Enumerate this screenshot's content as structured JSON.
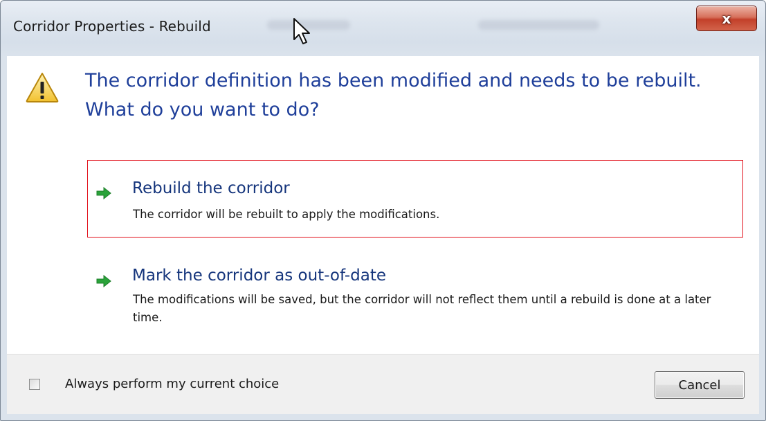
{
  "window": {
    "title": "Corridor Properties - Rebuild",
    "close_glyph": "x"
  },
  "main": {
    "heading": "The corridor definition has been modified and needs to be rebuilt. What do you want to do?",
    "icon": "warning-icon",
    "options": [
      {
        "title": "Rebuild the corridor",
        "description": "The corridor will be rebuilt to apply the modifications.",
        "icon": "green-arrow-icon",
        "selected": true
      },
      {
        "title": "Mark the corridor as out-of-date",
        "description": "The modifications will be saved, but the corridor will not reflect them until a rebuild is done at a later time.",
        "icon": "green-arrow-icon",
        "selected": false
      }
    ]
  },
  "footer": {
    "checkbox_label": "Always perform my current choice",
    "checkbox_checked": false,
    "cancel_label": "Cancel"
  },
  "colors": {
    "heading": "#1f3f9a",
    "option_title": "#15357c",
    "selection_outline": "#e2101a",
    "close_button": "#c3402a",
    "arrow": "#2aa33a"
  }
}
